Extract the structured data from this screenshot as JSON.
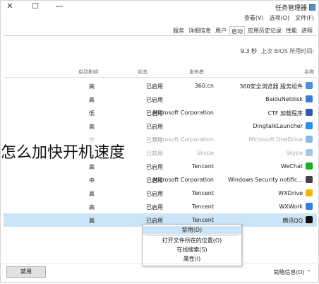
{
  "window": {
    "title": "任务管理器",
    "controls": {
      "close": "✕",
      "maximize": "☐",
      "minimize": "—"
    }
  },
  "menu": [
    "文件(F)",
    "选项(O)",
    "查看(V)"
  ],
  "tabs": [
    "服务",
    "详细信息",
    "用户",
    "启动",
    "应用历史记录",
    "性能",
    "进程"
  ],
  "active_tab": "启动",
  "bios": {
    "label": "上次 BIOS 所用时间:",
    "value": "9.3 秒"
  },
  "columns": {
    "name": "名称",
    "publisher": "发布者",
    "status": "状态",
    "impact": "启动影响"
  },
  "rows": [
    {
      "name": "360安全浏览器 服务组件",
      "publisher": "360.cn",
      "status": "已启用",
      "impact": "高",
      "icon": "shield-icon",
      "color": "#4a90d9"
    },
    {
      "name": "BaiduNetdisk",
      "publisher": "",
      "status": "已启用",
      "impact": "高",
      "icon": "cloud-icon",
      "color": "#3d7bd8"
    },
    {
      "name": "CTF 加载程序",
      "publisher": "Microsoft Corporation",
      "status": "已启用",
      "impact": "低",
      "icon": "pen-icon",
      "color": "#2f5fa8"
    },
    {
      "name": "DingtalkLauncher",
      "publisher": "",
      "status": "已启用",
      "impact": "高",
      "icon": "dingtalk-icon",
      "color": "#2a8fe8"
    },
    {
      "name": "Microsoft OneDrive",
      "publisher": "Microsoft Corporation",
      "status": "已禁用",
      "impact": "高",
      "icon": "onedrive-icon",
      "color": "#8ab8e6",
      "faded": true
    },
    {
      "name": "Skype",
      "publisher": "Skype",
      "status": "已禁用",
      "impact": "高",
      "icon": "skype-icon",
      "color": "#9fc8e8",
      "faded": true
    },
    {
      "name": "WeChat",
      "publisher": "Tencent",
      "status": "已启用",
      "impact": "高",
      "icon": "wechat-icon",
      "color": "#1aad19"
    },
    {
      "name": "Windows Security notific...",
      "publisher": "Microsoft Corporation",
      "status": "已启用",
      "impact": "中",
      "icon": "shield-outline-icon",
      "color": "#444444"
    },
    {
      "name": "WXDrive",
      "publisher": "Tencent",
      "status": "已启用",
      "impact": "高",
      "icon": "drive-icon",
      "color": "#f2b705"
    },
    {
      "name": "WXWork",
      "publisher": "Tencent",
      "status": "已启用",
      "impact": "高",
      "icon": "wxwork-icon",
      "color": "#2f7fe0"
    },
    {
      "name": "腾讯QQ",
      "publisher": "Tencent",
      "status": "已启用",
      "impact": "高",
      "icon": "qq-icon",
      "color": "#111111",
      "selected": true
    }
  ],
  "context_menu": [
    "禁用(D)",
    "打开文件所在的位置(O)",
    "在线搜索(S)",
    "属性(I)"
  ],
  "footer": {
    "disable": "禁用",
    "fewer": "简略信息(D)"
  },
  "overlay_text": "怎么加快开机速度"
}
